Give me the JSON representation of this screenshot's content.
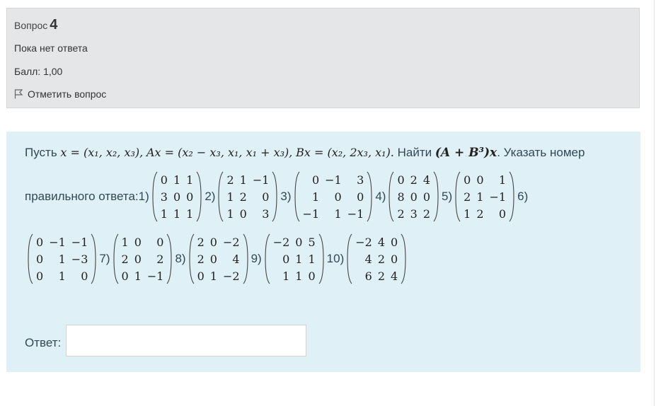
{
  "info": {
    "question_word": "Вопрос",
    "question_number": "4",
    "state": "Пока нет ответа",
    "grade": "Балл: 1,00",
    "flag_label": "Отметить вопрос"
  },
  "question": {
    "lead": "Пусть",
    "def_x": "x = (x₁, x₂, x₃),",
    "def_A": "Ax = (x₂ − x₃, x₁, x₁ + x₃),",
    "def_B": "Bx = (x₂, 2x₃, x₁).",
    "find_word": "Найти",
    "find_expr": "(A + B³)x",
    "instruction": ". Указать номер",
    "answer_prompt": "правильного ответа:",
    "options": [
      {
        "label": "1)",
        "rows": [
          [
            "0",
            "1",
            "1"
          ],
          [
            "3",
            "0",
            "0"
          ],
          [
            "1",
            "1",
            "1"
          ]
        ]
      },
      {
        "label": "2)",
        "rows": [
          [
            "2",
            "1",
            "−1"
          ],
          [
            "1",
            "2",
            "0"
          ],
          [
            "1",
            "0",
            "3"
          ]
        ]
      },
      {
        "label": "3)",
        "rows": [
          [
            "0",
            "−1",
            "3"
          ],
          [
            "1",
            "0",
            "0"
          ],
          [
            "−1",
            "1",
            "−1"
          ]
        ]
      },
      {
        "label": "4)",
        "rows": [
          [
            "0",
            "2",
            "4"
          ],
          [
            "8",
            "0",
            "0"
          ],
          [
            "2",
            "3",
            "2"
          ]
        ]
      },
      {
        "label": "5)",
        "rows": [
          [
            "0",
            "0",
            "1"
          ],
          [
            "2",
            "1",
            "−1"
          ],
          [
            "1",
            "2",
            "0"
          ]
        ]
      },
      {
        "label": "6)",
        "rows": [
          [
            "0",
            "−1",
            "−1"
          ],
          [
            "0",
            "1",
            "−3"
          ],
          [
            "0",
            "1",
            "0"
          ]
        ]
      },
      {
        "label": "7)",
        "rows": [
          [
            "1",
            "0",
            "0"
          ],
          [
            "2",
            "0",
            "2"
          ],
          [
            "0",
            "1",
            "−1"
          ]
        ]
      },
      {
        "label": "8)",
        "rows": [
          [
            "2",
            "0",
            "−2"
          ],
          [
            "2",
            "0",
            "4"
          ],
          [
            "0",
            "1",
            "−2"
          ]
        ]
      },
      {
        "label": "9)",
        "rows": [
          [
            "−2",
            "0",
            "5"
          ],
          [
            "0",
            "1",
            "1"
          ],
          [
            "1",
            "1",
            "0"
          ]
        ]
      },
      {
        "label": "10)",
        "rows": [
          [
            "−2",
            "4",
            "0"
          ],
          [
            "4",
            "2",
            "0"
          ],
          [
            "6",
            "2",
            "4"
          ]
        ]
      }
    ]
  },
  "answer": {
    "label": "Ответ:",
    "value": ""
  },
  "icons": {
    "flag": "flag-icon"
  }
}
